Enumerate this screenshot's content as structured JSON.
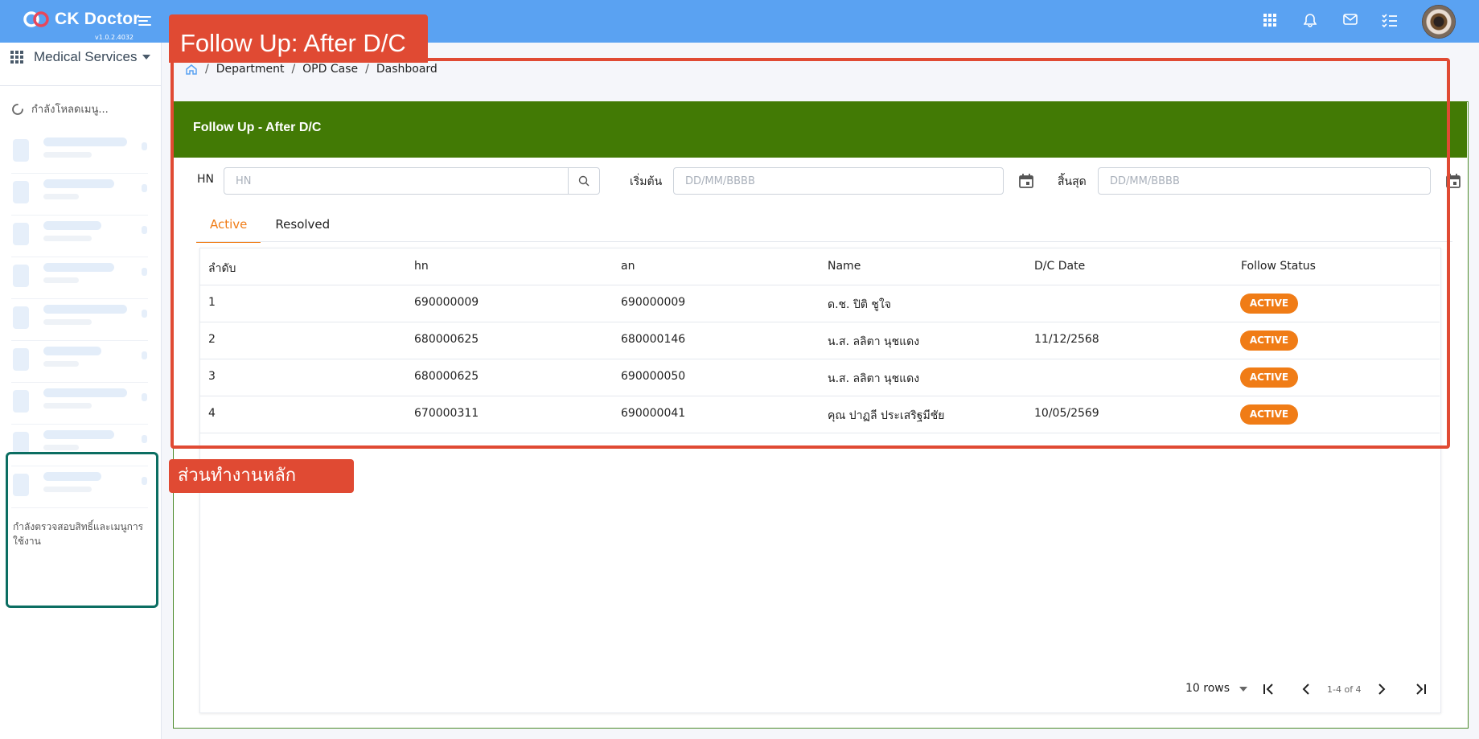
{
  "app": {
    "brand": "CK Doctor",
    "version": "v1.0.2.4032"
  },
  "sidebar": {
    "service_label": "Medical Services",
    "loading_text": "กำลังโหลดเมนู...",
    "permission_text": "กำลังตรวจสอบสิทธิ์และเมนูการใช้งาน"
  },
  "breadcrumb": [
    "Department",
    "OPD Case",
    "Dashboard"
  ],
  "card": {
    "title": "Follow Up - After D/C"
  },
  "filters": {
    "hn_label": "HN",
    "hn_placeholder": "HN",
    "start_label": "เริ่มต้น",
    "start_placeholder": "DD/MM/BBBB",
    "end_label": "สิ้นสุด",
    "end_placeholder": "DD/MM/BBBB"
  },
  "tabs": [
    {
      "label": "Active",
      "active": true
    },
    {
      "label": "Resolved",
      "active": false
    }
  ],
  "table": {
    "columns": [
      "ลำดับ",
      "hn",
      "an",
      "Name",
      "D/C Date",
      "Follow Status"
    ],
    "rows": [
      [
        "1",
        "690000009",
        "690000009",
        "ด.ช. ปิติ ชูใจ",
        "",
        "ACTIVE"
      ],
      [
        "2",
        "680000625",
        "680000146",
        "น.ส. ลลิตา นุชแดง",
        "11/12/2568",
        "ACTIVE"
      ],
      [
        "3",
        "680000625",
        "690000050",
        "น.ส. ลลิตา นุชแดง",
        "",
        "ACTIVE"
      ],
      [
        "4",
        "670000311",
        "690000041",
        "คุณ ปาฏลี ประเสริฐมีชัย",
        "10/05/2569",
        "ACTIVE"
      ]
    ]
  },
  "pagination": {
    "rows_per_page": "10 rows",
    "range": "1-4 of 4"
  },
  "annotations": {
    "title": "Follow Up: After D/C",
    "main_area": "ส่วนทำงานหลัก"
  },
  "colors": {
    "topbar": "#5aa2f2",
    "header_green": "#427a05",
    "accent_orange": "#f07c16",
    "annotation_red": "#e04a33",
    "annotation_teal": "#0b6e62"
  }
}
